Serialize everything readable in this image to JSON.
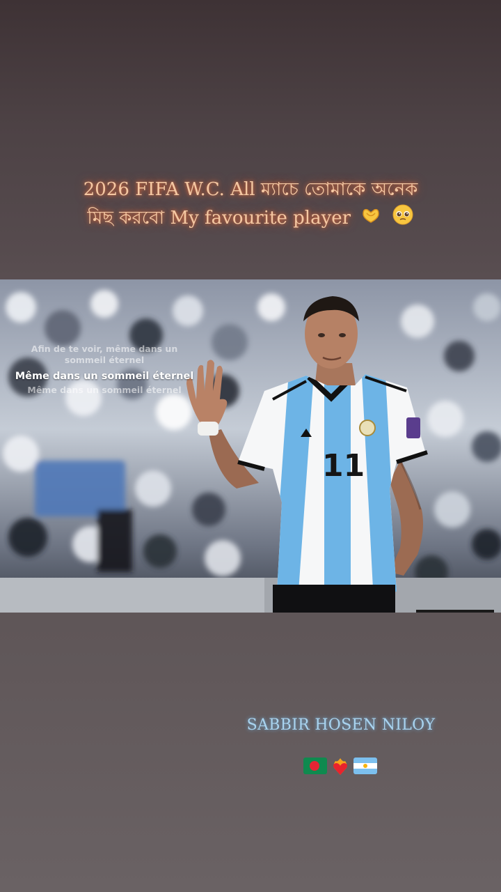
{
  "caption": {
    "line1": "2026 FIFA W.C. All ম্যাচে তোমাকে অনেক",
    "line2": "মিছ করবো My favourite player",
    "emojis": [
      "heart-hands-icon",
      "pleading-face-icon"
    ]
  },
  "lyrics": {
    "previous": "Afin de te voir, même dans un sommeil éternel",
    "current": "Même dans un sommeil éternel",
    "next": "Même dans un sommeil éternel"
  },
  "author": {
    "name": "SABBIR HOSEN NILOY"
  },
  "flags": [
    "bangladesh-flag-icon",
    "heart-on-fire-icon",
    "argentina-flag-icon"
  ],
  "photo": {
    "jersey_number": "11"
  },
  "colors": {
    "caption_glow": "#ff7a3c",
    "author_text": "#a9d4f0",
    "jersey_stripe": "#6db4e6"
  }
}
